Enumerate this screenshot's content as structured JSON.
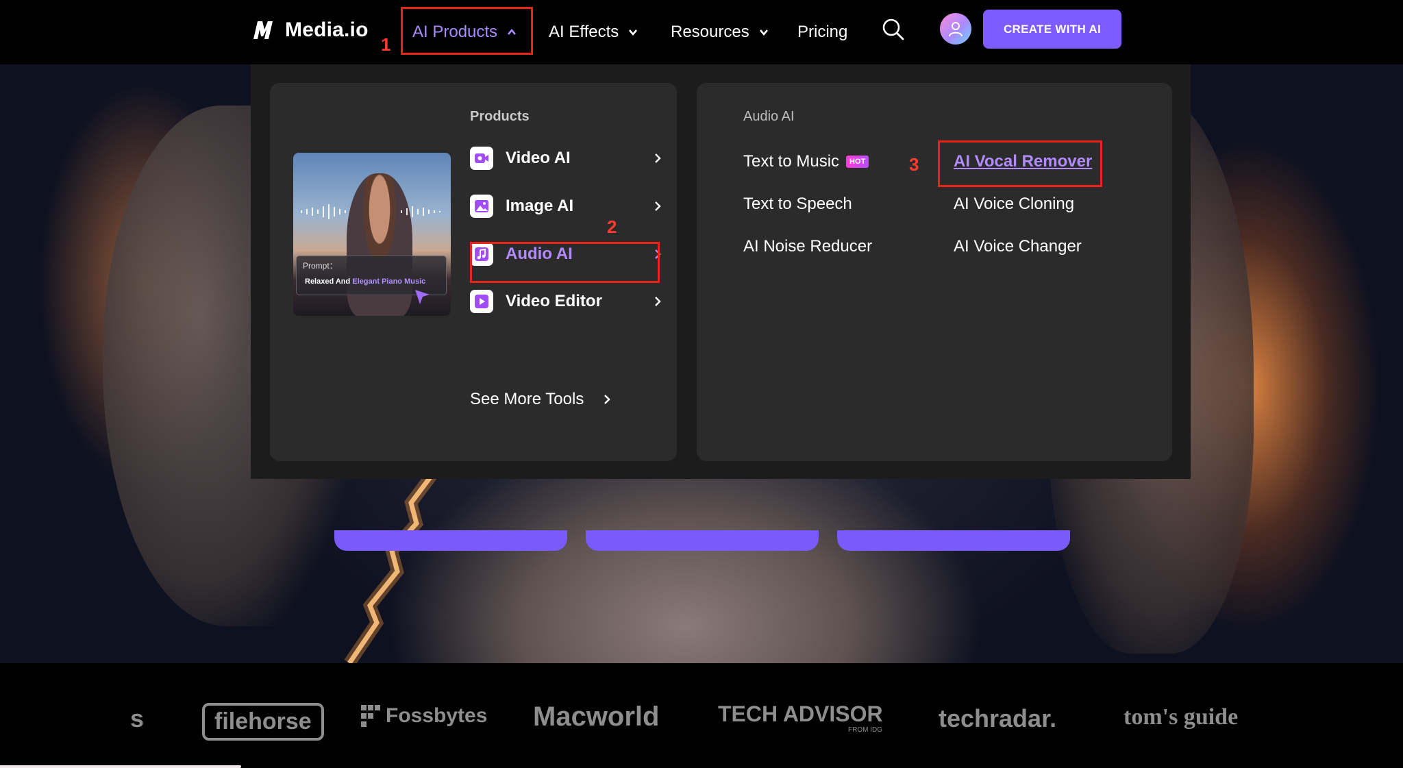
{
  "nav": {
    "brand": "Media.io",
    "items": [
      {
        "label": "AI Products",
        "active": true
      },
      {
        "label": "AI Effects"
      },
      {
        "label": "Resources"
      },
      {
        "label": "Pricing"
      }
    ],
    "cta_label": "CREATE WITH AI",
    "accent_color": "#7d5bff"
  },
  "mega_menu": {
    "products_title": "Products",
    "thumbnail": {
      "prompt_label": "Prompt：",
      "prompt_text_a": "Relaxed And ",
      "prompt_text_b": "Elegant Piano Music"
    },
    "products": [
      {
        "label": "Video AI",
        "icon": "video-ai-icon"
      },
      {
        "label": "Image AI",
        "icon": "image-ai-icon"
      },
      {
        "label": "Audio AI",
        "icon": "audio-ai-icon",
        "active": true
      },
      {
        "label": "Video Editor",
        "icon": "video-editor-icon"
      }
    ],
    "see_more_label": "See More Tools",
    "audio_title": "Audio AI",
    "audio_tools_left": [
      {
        "label": "Text to Music",
        "badge": "HOT"
      },
      {
        "label": "Text to Speech"
      },
      {
        "label": "AI Noise Reducer"
      }
    ],
    "audio_tools_right": [
      {
        "label": "AI Vocal Remover",
        "selected": true
      },
      {
        "label": "AI Voice Cloning"
      },
      {
        "label": "AI Voice Changer"
      }
    ]
  },
  "annotations": [
    "1",
    "2",
    "3"
  ],
  "press": {
    "logos": [
      "s",
      "filehorse",
      "Fossbytes",
      "Macworld",
      "TECH ADVISOR",
      "FROM IDG",
      "techradar.",
      "tom's guide"
    ]
  }
}
